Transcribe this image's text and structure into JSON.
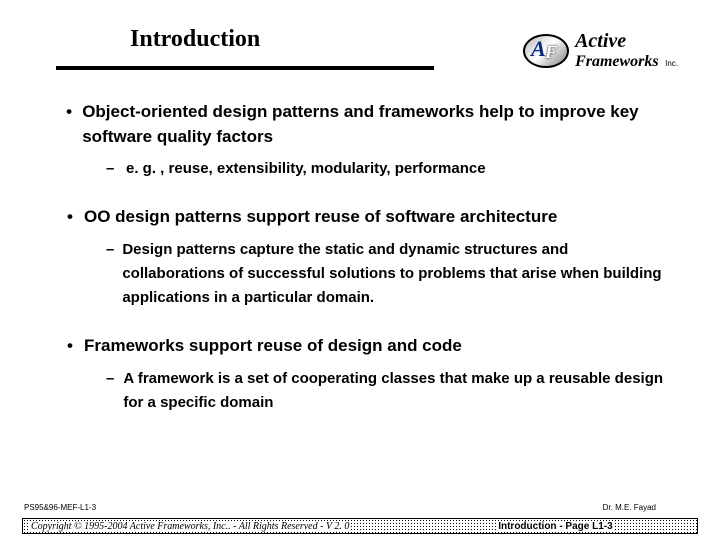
{
  "header": {
    "title": "Introduction",
    "logo": {
      "line1": "Active",
      "line2": "Frameworks",
      "inc": "Inc."
    }
  },
  "body": {
    "bullets": [
      {
        "text": "Object-oriented design patterns and frameworks help to improve key software quality factors",
        "subs": [
          "e. g. , reuse, extensibility, modularity, performance"
        ]
      },
      {
        "text": "OO design patterns support reuse of software architecture",
        "subs": [
          "Design patterns capture the static and dynamic structures and collaborations of successful solutions to problems that arise when building applications in a particular domain."
        ]
      },
      {
        "text": "Frameworks support reuse of design and code",
        "subs": [
          "A framework is a set of cooperating classes that make up a reusable design for a specific domain"
        ]
      }
    ]
  },
  "footer": {
    "project_id": "PS95&96-MEF-L1-3",
    "author": "Dr. M.E. Fayad",
    "copyright": "Copyright © 1995-2004 Active Frameworks, Inc.. - All Rights Reserved - V 2. 0",
    "page_label": "Introduction - Page L1-3"
  }
}
